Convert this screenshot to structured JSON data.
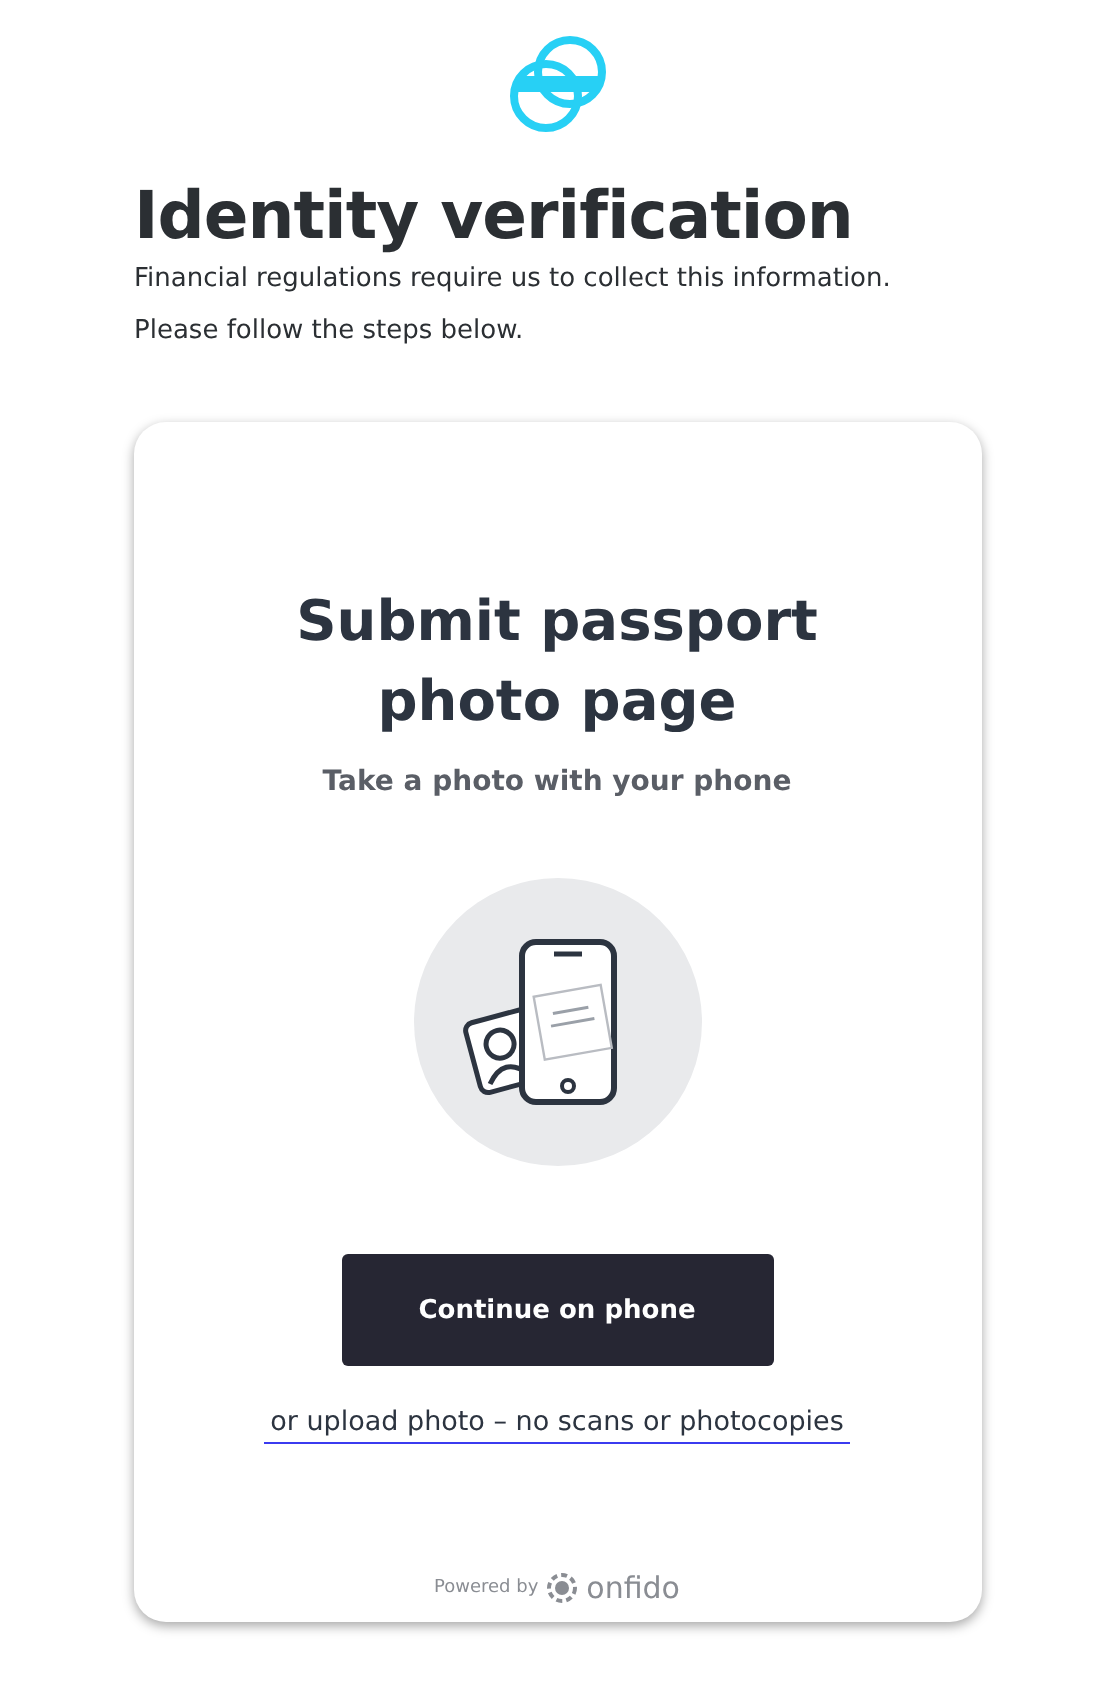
{
  "header": {
    "title": "Identity verification",
    "description_lines": [
      "Financial regulations require us to collect this information.",
      "Please follow the steps below."
    ]
  },
  "card": {
    "title": "Submit passport photo page",
    "subtitle": "Take a photo with your phone",
    "button": "Continue on phone",
    "link": "or upload photo – no scans or photocopies",
    "footer": {
      "powered_by": "Powered by",
      "brand": "onfido"
    }
  }
}
